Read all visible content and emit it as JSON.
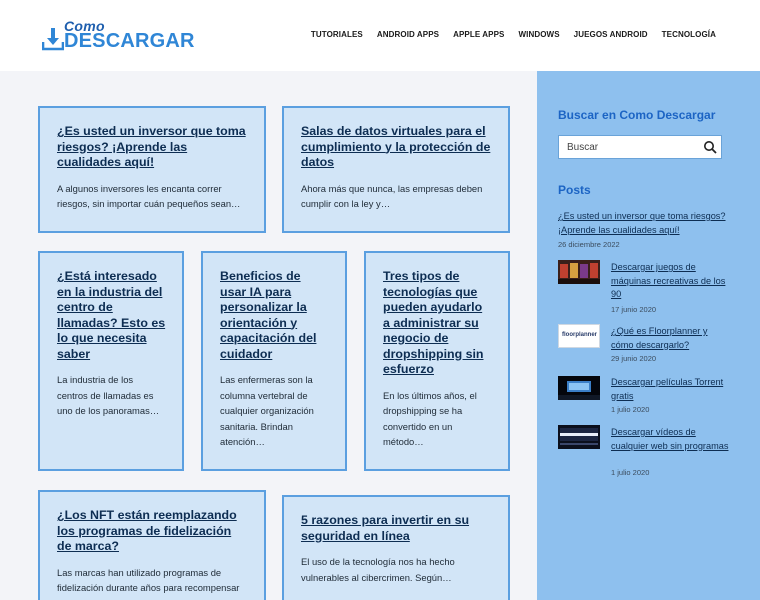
{
  "header": {
    "logo_top": "Como",
    "logo_bottom": "DESCARGAR",
    "nav": [
      "TUTORIALES",
      "ANDROID APPS",
      "APPLE APPS",
      "WINDOWS",
      "JUEGOS ANDROID",
      "TECNOLOGÍA"
    ]
  },
  "cards": [
    {
      "title": "¿Es usted un inversor que toma riesgos? ¡Aprende las cualidades aquí!",
      "excerpt": "A algunos inversores les encanta correr riesgos, sin importar cuán pequeños sean…"
    },
    {
      "title": "Salas de datos virtuales para el cumplimiento y la protección de datos",
      "excerpt": "Ahora más que nunca, las empresas deben cumplir con la ley y…"
    },
    {
      "title": "¿Está interesado en la industria del centro de llamadas? Esto es lo que necesita saber",
      "excerpt": "La industria de los centros de llamadas es uno de los panoramas…"
    },
    {
      "title": "Beneficios de usar IA para personalizar la orientación y capacitación del cuidador",
      "excerpt": "Las enfermeras son la columna vertebral de cualquier organización sanitaria. Brindan atención…"
    },
    {
      "title": "Tres tipos de tecnologías que pueden ayudarlo a administrar su negocio de dropshipping sin esfuerzo",
      "excerpt": "En los últimos años, el dropshipping se ha convertido en un método…"
    },
    {
      "title": "¿Los NFT están reemplazando los programas de fidelización de marca?",
      "excerpt": "Las marcas han utilizado programas de fidelización durante años para recompensar"
    },
    {
      "title": "5 razones para invertir en su seguridad en línea",
      "excerpt": "El uso de la tecnología nos ha hecho vulnerables al cibercrimen. Según…"
    }
  ],
  "sidebar": {
    "search_heading": "Buscar en Como Descargar",
    "search_placeholder": "Buscar",
    "posts_heading": "Posts",
    "posts": [
      {
        "title": "¿Es usted un inversor que toma riesgos? ¡Aprende las cualidades aquí!",
        "date": "26 diciembre 2022"
      },
      {
        "title": "Descargar juegos de máquinas recreativas de los 90",
        "date": "17 junio 2020"
      },
      {
        "title": "¿Qué es Floorplanner y cómo descargarlo?",
        "date": "29 junio 2020",
        "thumb_text": "floorplanner"
      },
      {
        "title": "Descargar películas Torrent gratis",
        "date": "1 julio 2020"
      },
      {
        "title": "Descargar vídeos de cualquier web sin programas",
        "date": "1 julio 2020"
      }
    ]
  },
  "colors": {
    "accent": "#1c64c4",
    "card_bg": "#d2e5f7",
    "card_border": "#5b9fe0",
    "sidebar_bg": "#8ec0ee"
  }
}
